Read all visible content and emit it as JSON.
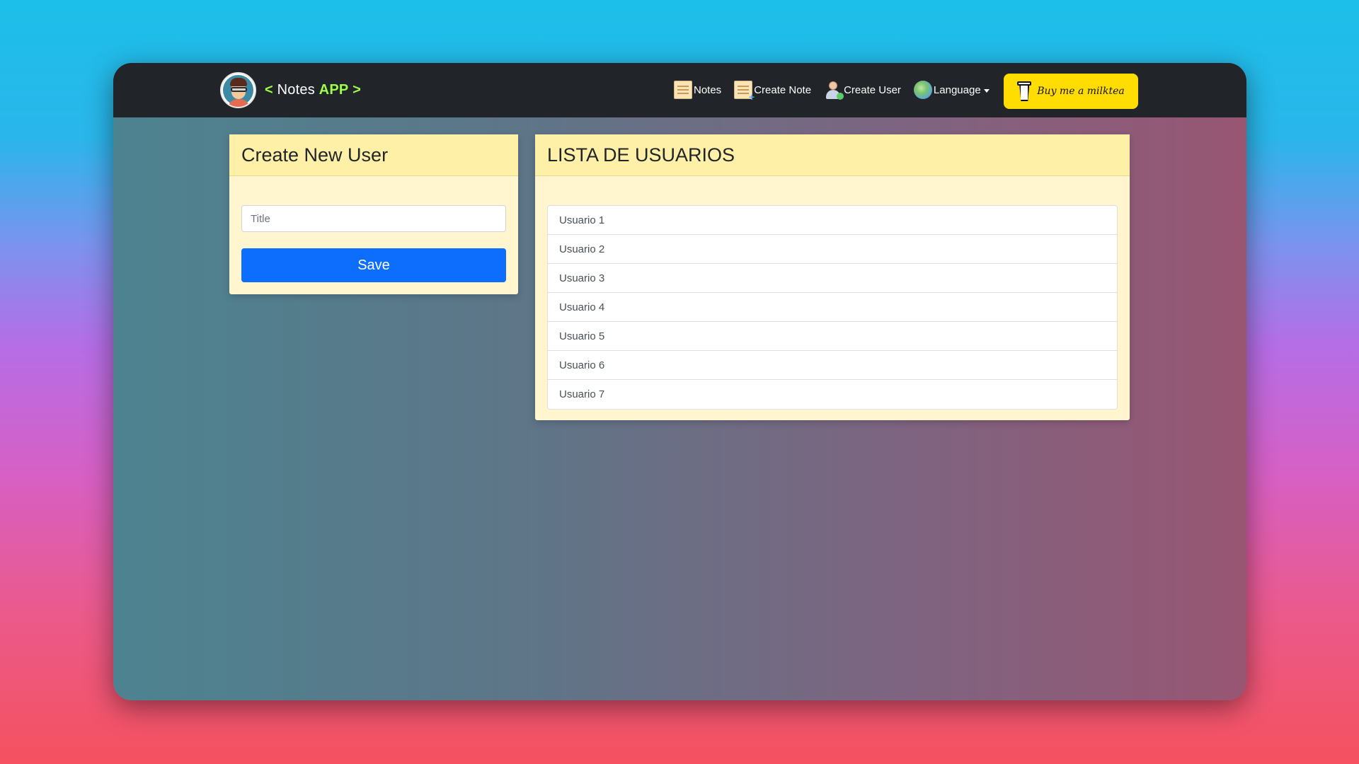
{
  "navbar": {
    "brand": {
      "prefix": "<",
      "name": "Notes",
      "highlight": "APP",
      "suffix": ">"
    },
    "links": [
      {
        "label": "Notes",
        "icon": "note-icon"
      },
      {
        "label": "Create Note",
        "icon": "create-note-icon"
      },
      {
        "label": "Create User",
        "icon": "user-icon"
      },
      {
        "label": "Language",
        "icon": "globe-icon"
      }
    ],
    "donate_button": {
      "label": "Buy me a milktea",
      "icon": "cup-icon"
    }
  },
  "create_user": {
    "title": "Create New User",
    "input_placeholder": "Title",
    "input_value": "",
    "save_label": "Save"
  },
  "user_list": {
    "title": "LISTA DE USUARIOS",
    "items": [
      "Usuario 1",
      "Usuario 2",
      "Usuario 3",
      "Usuario 4",
      "Usuario 5",
      "Usuario 6",
      "Usuario 7"
    ]
  },
  "colors": {
    "navbar": "#212529",
    "brand_accent": "#9efc4a",
    "card_header": "#fff0a8",
    "card_body": "#fff6cf",
    "primary_button": "#0d6efd",
    "donate_button": "#ffdd00"
  }
}
